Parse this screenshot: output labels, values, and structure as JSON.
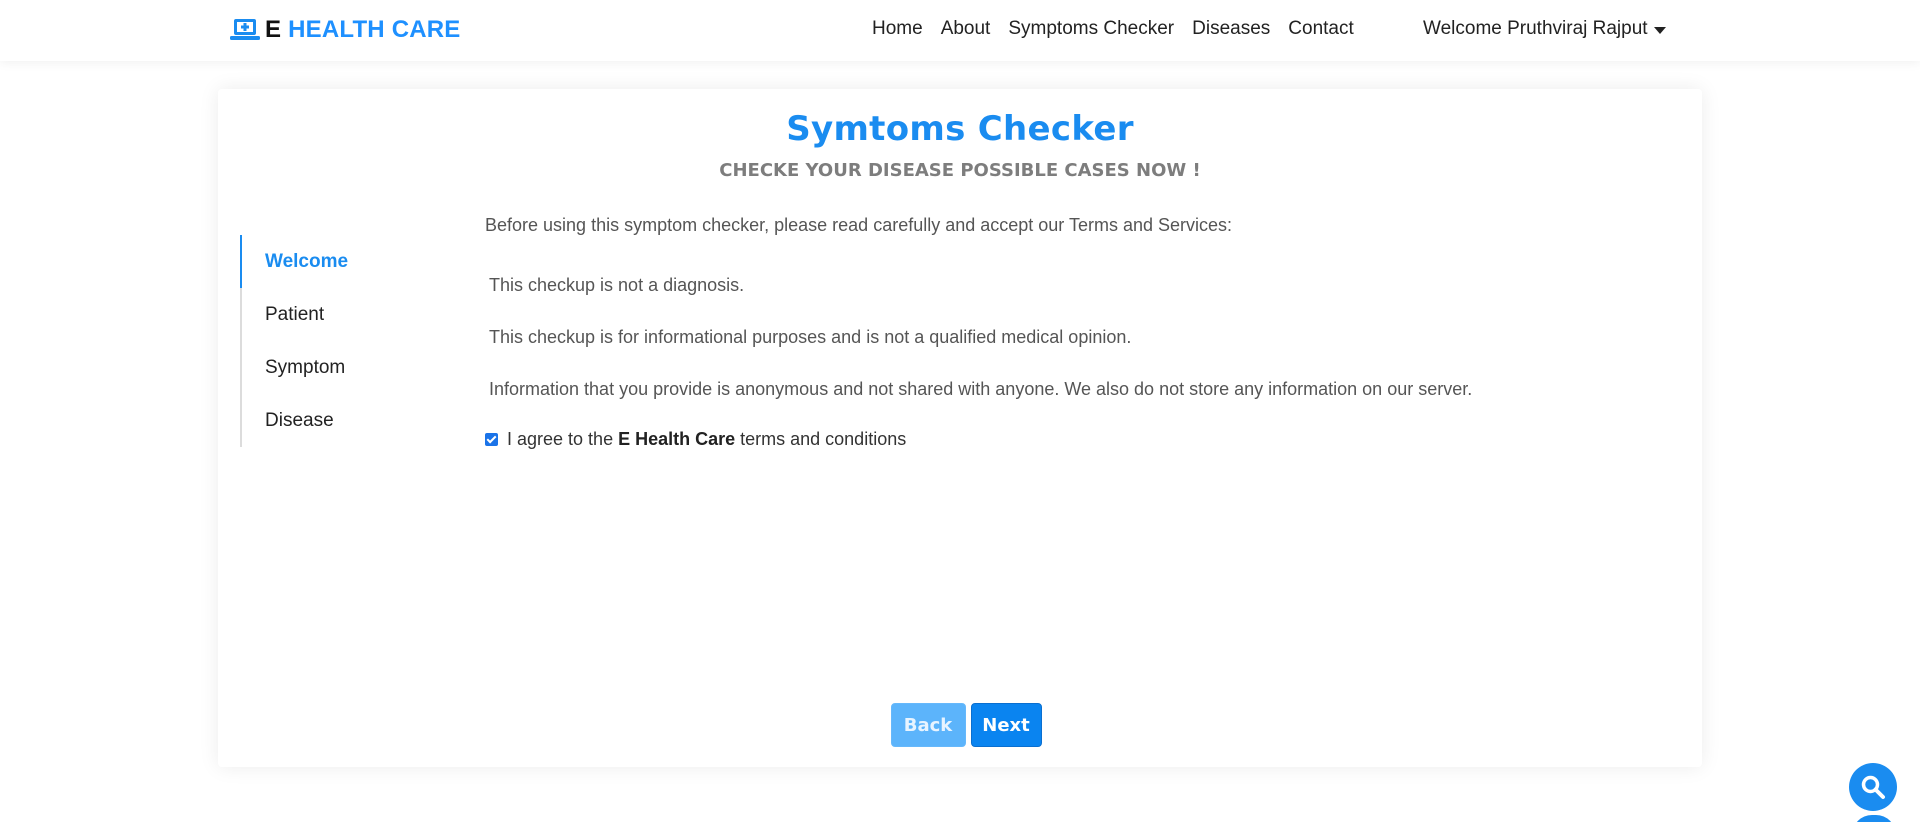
{
  "nav": {
    "brand_e": "E",
    "brand_rest": "HEALTH CARE",
    "links": [
      "Home",
      "About",
      "Symptoms Checker",
      "Diseases",
      "Contact"
    ],
    "user_menu_label": "Welcome Pruthviraj Rajput"
  },
  "header": {
    "title": "Symtoms Checker",
    "subtitle": "CHECKE YOUR DISEASE POSSIBLE CASES NOW !"
  },
  "steps": [
    {
      "label": "Welcome",
      "active": true
    },
    {
      "label": "Patient",
      "active": false
    },
    {
      "label": "Symptom",
      "active": false
    },
    {
      "label": "Disease",
      "active": false
    }
  ],
  "content": {
    "intro": "Before using this symptom checker, please read carefully and accept our Terms and Services:",
    "terms": [
      "This checkup is not a diagnosis.",
      "This checkup is for informational purposes and is not a qualified medical opinion.",
      "Information that you provide is anonymous and not shared with anyone. We also do not store any information on our server."
    ],
    "agree_prefix": "I agree to the",
    "agree_brand": "E Health Care",
    "agree_suffix": "terms and conditions",
    "agree_checked": true
  },
  "buttons": {
    "back": "Back",
    "next": "Next"
  },
  "colors": {
    "accent": "#1a8cf0",
    "back_button": "#5cb4fb",
    "next_button": "#0a84f0"
  },
  "icons": {
    "brand": "laptop-medical-icon",
    "fab": "search-icon"
  }
}
